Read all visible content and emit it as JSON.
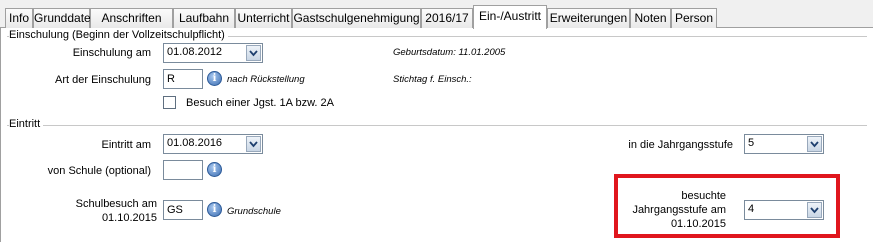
{
  "tabs": [
    "Info",
    "Grunddaten",
    "Anschriften",
    "Laufbahn",
    "Unterricht",
    "Gastschulgenehmigung",
    "2016/17",
    "Ein-/Austritt",
    "Erweiterungen",
    "Noten",
    "Person"
  ],
  "active_tab": "Ein-/Austritt",
  "einschulung": {
    "section_title": "Einschulung (Beginn der Vollzeitschulpflicht)",
    "date_label": "Einschulung am",
    "date_value": "01.08.2012",
    "geburtsdatum": "Geburtsdatum: 11.01.2005",
    "art_label": "Art der Einschulung",
    "art_value": "R",
    "art_desc": "nach Rückstellung",
    "stichtag": "Stichtag f. Einsch.:",
    "checkbox_label": "Besuch einer Jgst. 1A bzw. 2A"
  },
  "eintritt": {
    "section_title": "Eintritt",
    "date_label": "Eintritt am",
    "date_value": "01.08.2016",
    "stufe_label": "in die Jahrgangsstufe",
    "stufe_value": "5",
    "schule_label": "von Schule (optional)",
    "schule_value": "",
    "schulbesuch_label_1": "Schulbesuch am",
    "schulbesuch_label_2": "01.10.2015",
    "schulbesuch_value": "GS",
    "schulbesuch_desc": "Grundschule",
    "besuchte_label_1": "besuchte",
    "besuchte_label_2": "Jahrgangsstufe am",
    "besuchte_label_3": "01.10.2015",
    "besuchte_value": "4"
  },
  "icons": {
    "info": "i",
    "dropdown": "chevron-down-icon"
  },
  "colors": {
    "highlight": "#e0161d",
    "tab_border": "#a0a0a0",
    "info_icon": "#3a6cb0"
  }
}
